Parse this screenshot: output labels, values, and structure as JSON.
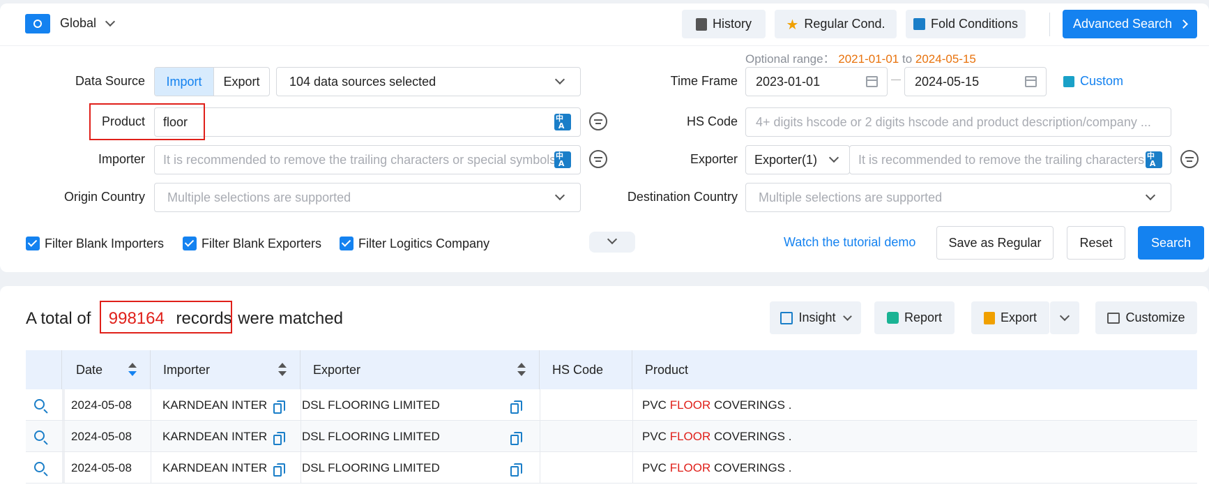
{
  "header": {
    "scope_label": "Global",
    "history_label": "History",
    "regular_cond_label": "Regular Cond.",
    "fold_label": "Fold Conditions",
    "advanced_label": "Advanced Search"
  },
  "form": {
    "optional_range_label": "Optional range：",
    "optional_range_start": "2021-01-01",
    "optional_range_to": "to",
    "optional_range_end": "2024-05-15",
    "data_source_label": "Data Source",
    "import_label": "Import",
    "export_label": "Export",
    "sources_value": "104 data sources selected",
    "time_frame_label": "Time Frame",
    "date_start": "2023-01-01",
    "date_sep": "—",
    "date_end": "2024-05-15",
    "custom_label": "Custom",
    "product_label": "Product",
    "product_value": "floor",
    "hs_code_label": "HS Code",
    "hs_code_placeholder": "4+ digits hscode or 2 digits hscode and product description/company ...",
    "importer_label": "Importer",
    "importer_placeholder": "It is recommended to remove the trailing characters or special symbols",
    "exporter_label": "Exporter",
    "exporter_select": "Exporter(1)",
    "exporter_placeholder": "It is recommended to remove the trailing characters",
    "origin_label": "Origin Country",
    "origin_placeholder": "Multiple selections are supported",
    "destination_label": "Destination Country",
    "destination_placeholder": "Multiple selections are supported",
    "filter_importers": "Filter Blank Importers",
    "filter_exporters": "Filter Blank Exporters",
    "filter_logistics": "Filter Logitics Company",
    "tutorial_label": "Watch the tutorial demo",
    "save_regular_label": "Save as Regular",
    "reset_label": "Reset",
    "search_label": "Search"
  },
  "results": {
    "prefix": "A total of",
    "count": "998164",
    "records": "records",
    "suffix": "were matched",
    "insight_label": "Insight",
    "report_label": "Report",
    "export_label": "Export",
    "customize_label": "Customize",
    "columns": {
      "date": "Date",
      "importer": "Importer",
      "exporter": "Exporter",
      "hs_code": "HS Code",
      "product": "Product"
    },
    "rows": [
      {
        "date": "2024-05-08",
        "importer": "KARNDEAN INTER",
        "exporter": "DSL FLOORING LIMITED",
        "hs_code": "",
        "product_pre": "PVC",
        "product_hl": "FLOOR",
        "product_post": "COVERINGS ."
      },
      {
        "date": "2024-05-08",
        "importer": "KARNDEAN INTER",
        "exporter": "DSL FLOORING LIMITED",
        "hs_code": "",
        "product_pre": "PVC",
        "product_hl": "FLOOR",
        "product_post": "COVERINGS ."
      },
      {
        "date": "2024-05-08",
        "importer": "KARNDEAN INTER",
        "exporter": "DSL FLOORING LIMITED",
        "hs_code": "",
        "product_pre": "PVC",
        "product_hl": "FLOOR",
        "product_post": "COVERINGS ."
      }
    ]
  },
  "colors": {
    "accent": "#1482f0",
    "highlight": "#e0201a",
    "range_date": "#e8720c"
  }
}
